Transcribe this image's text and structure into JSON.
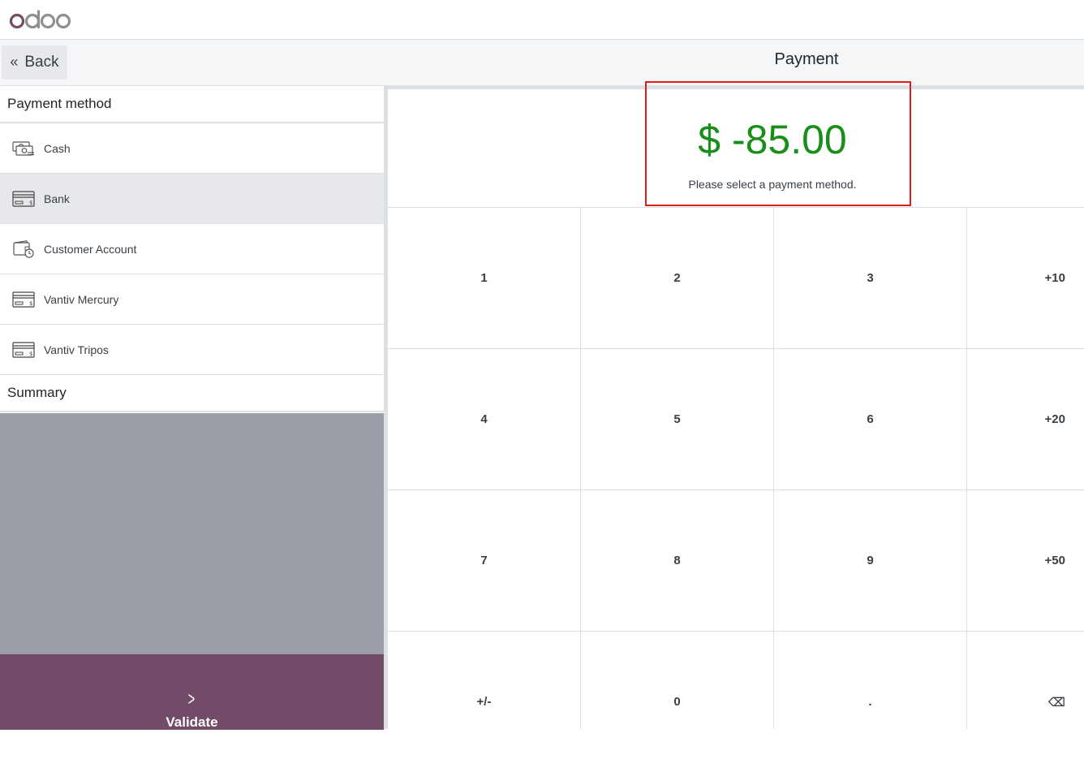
{
  "header": {
    "logo_text": "odoo",
    "back_label": "Back",
    "title": "Payment"
  },
  "payment_methods": {
    "heading": "Payment method",
    "items": [
      {
        "label": "Cash",
        "icon": "cash-icon",
        "active": false
      },
      {
        "label": "Bank",
        "icon": "card-icon",
        "active": true
      },
      {
        "label": "Customer Account",
        "icon": "wallet-clock-icon",
        "active": false
      },
      {
        "label": "Vantiv Mercury",
        "icon": "card-icon",
        "active": false
      },
      {
        "label": "Vantiv Tripos",
        "icon": "card-icon",
        "active": false
      }
    ]
  },
  "summary": {
    "heading": "Summary"
  },
  "validate": {
    "label": "Validate",
    "icon": "chevron-right-icon"
  },
  "amount": {
    "value": "$ -85.00",
    "message": "Please select a payment method."
  },
  "numpad": {
    "keys": [
      "1",
      "2",
      "3",
      "+10",
      "4",
      "5",
      "6",
      "+20",
      "7",
      "8",
      "9",
      "+50",
      "+/-",
      "0",
      ".",
      "⌫"
    ]
  },
  "colors": {
    "brand": "#714b67",
    "amount": "#1a8e1a",
    "highlight": "#e01b1b",
    "summary_bg": "#9a9ea6"
  }
}
